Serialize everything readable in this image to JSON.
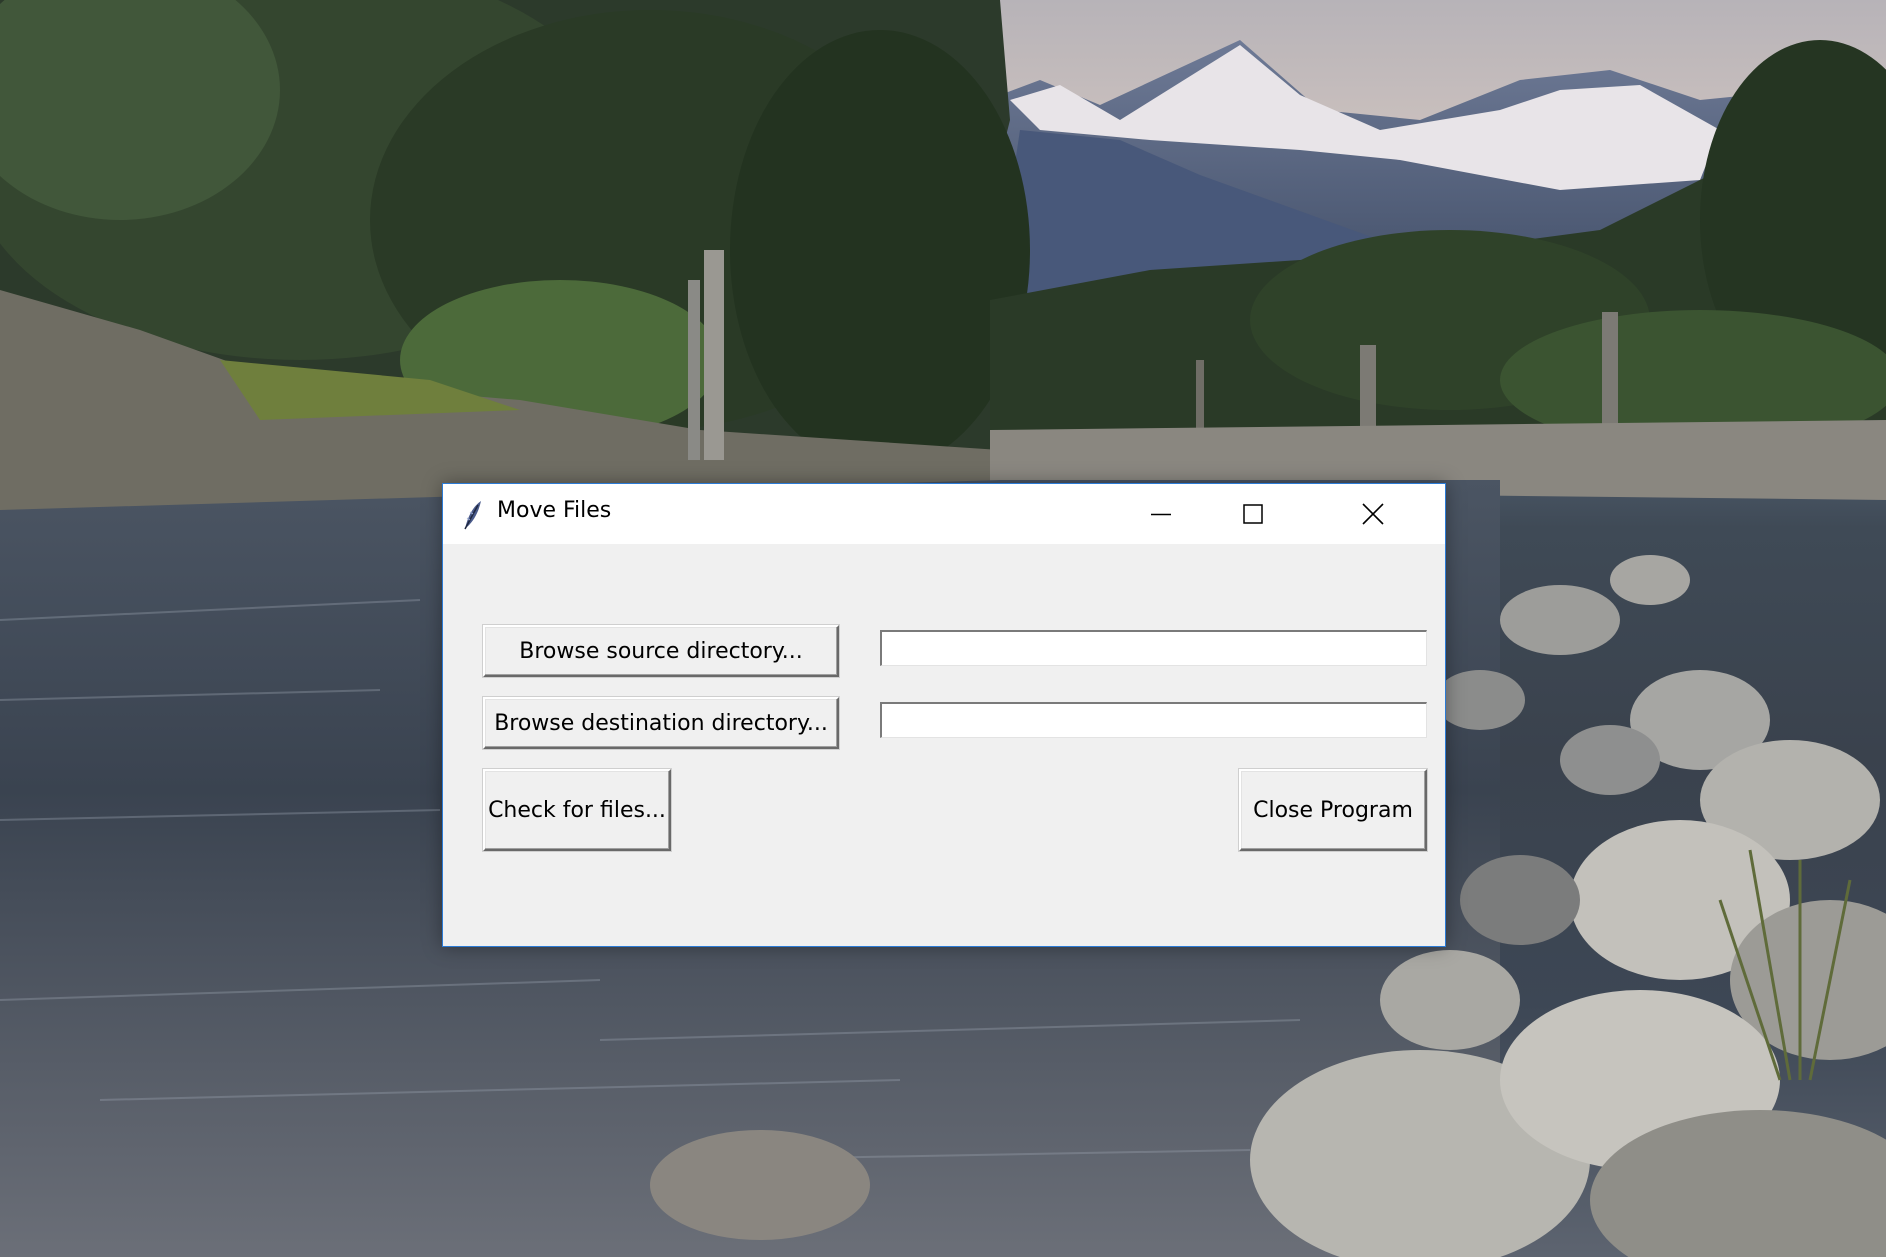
{
  "window": {
    "title": "Move Files",
    "icon": "feather-icon",
    "caption_buttons": [
      "minimize-icon",
      "maximize-icon",
      "close-icon"
    ]
  },
  "form": {
    "source_button_label": "Browse source directory...",
    "source_value": "",
    "destination_button_label": "Browse destination directory...",
    "destination_value": "",
    "check_button_label": "Check for files...",
    "close_button_label": "Close Program"
  },
  "colors": {
    "window_background": "#f0f0f0",
    "titlebar_background": "#ffffff",
    "window_border_accent": "#2b7bd6"
  }
}
